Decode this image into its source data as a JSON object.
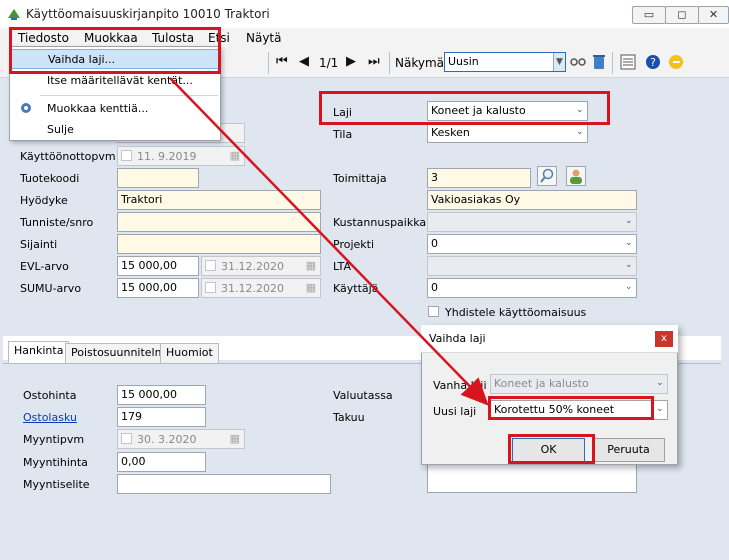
{
  "window": {
    "title": "Käyttöomaisuuskirjanpito 10010 Traktori",
    "minimize_label": "▭",
    "maximize_label": "◻",
    "close_label": "✕"
  },
  "menubar": {
    "items": [
      "Tiedosto",
      "Muokkaa",
      "Tulosta",
      "Etsi",
      "Näytä"
    ]
  },
  "file_menu": {
    "items": [
      "Vaihda laji...",
      "Itse määritellävät kentät...",
      "Muokkaa kenttiä...",
      "Sulje"
    ]
  },
  "toolbar": {
    "record_position": "1/1",
    "view_label": "Näkymä",
    "view_value": "Uusin"
  },
  "form": {
    "kayttoonottopvm_label": "Käyttöönottopvm",
    "kayttoonottopvm_value": "11.  9.2019",
    "tuotekoodi_label": "Tuotekoodi",
    "tuotekoodi_value": "",
    "hyodyke_label": "Hyödyke",
    "hyodyke_value": "Traktori",
    "tunniste_label": "Tunniste/snro",
    "tunniste_value": "",
    "sijainti_label": "Sijainti",
    "sijainti_value": "",
    "evl_label": "EVL-arvo",
    "evl_value": "15 000,00",
    "evl_date": "31.12.2020",
    "sumu_label": "SUMU-arvo",
    "sumu_value": "15 000,00",
    "sumu_date": "31.12.2020",
    "laji_label": "Laji",
    "laji_value": "Koneet ja kalusto",
    "tila_label": "Tila",
    "tila_value": "Kesken",
    "toimittaja_label": "Toimittaja",
    "toimittaja_value": "3",
    "toimittaja_name": "Vakioasiakas Oy",
    "kustannuspaikka_label": "Kustannuspaikka",
    "kustannuspaikka_value": "",
    "projekti_label": "Projekti",
    "projekti_value": "0",
    "lta_label": "LTA",
    "lta_value": "",
    "kayttaja_label": "Käyttäjä",
    "kayttaja_value": "0",
    "yhdistele_label": "Yhdistele käyttöomaisuus"
  },
  "tabs": [
    "Hankinta",
    "Poistosuunnitelma",
    "Huomiot"
  ],
  "hankinta": {
    "ostohinta_label": "Ostohinta",
    "ostohinta_value": "15 000,00",
    "ostolasku_label": "Ostolasku",
    "ostolasku_value": "179",
    "myyntipvm_label": "Myyntipvm",
    "myyntipvm_value": "30.  3.2020",
    "myyntihinta_label": "Myyntihinta",
    "myyntihinta_value": "0,00",
    "myyntiselite_label": "Myyntiselite",
    "myyntiselite_value": "",
    "valuutassa_label": "Valuutassa",
    "takuu_label": "Takuu"
  },
  "dialog": {
    "title": "Vaihda laji",
    "close_label": "x",
    "vanha_label": "Vanha laji",
    "vanha_value": "Koneet ja kalusto",
    "uusi_label": "Uusi laji",
    "uusi_value": "Korotettu 50% koneet",
    "ok_label": "OK",
    "cancel_label": "Peruuta"
  },
  "colors": {
    "highlight_red": "#d8141e",
    "form_bg": "#dfe6f0",
    "required_field": "#fff9e6"
  }
}
